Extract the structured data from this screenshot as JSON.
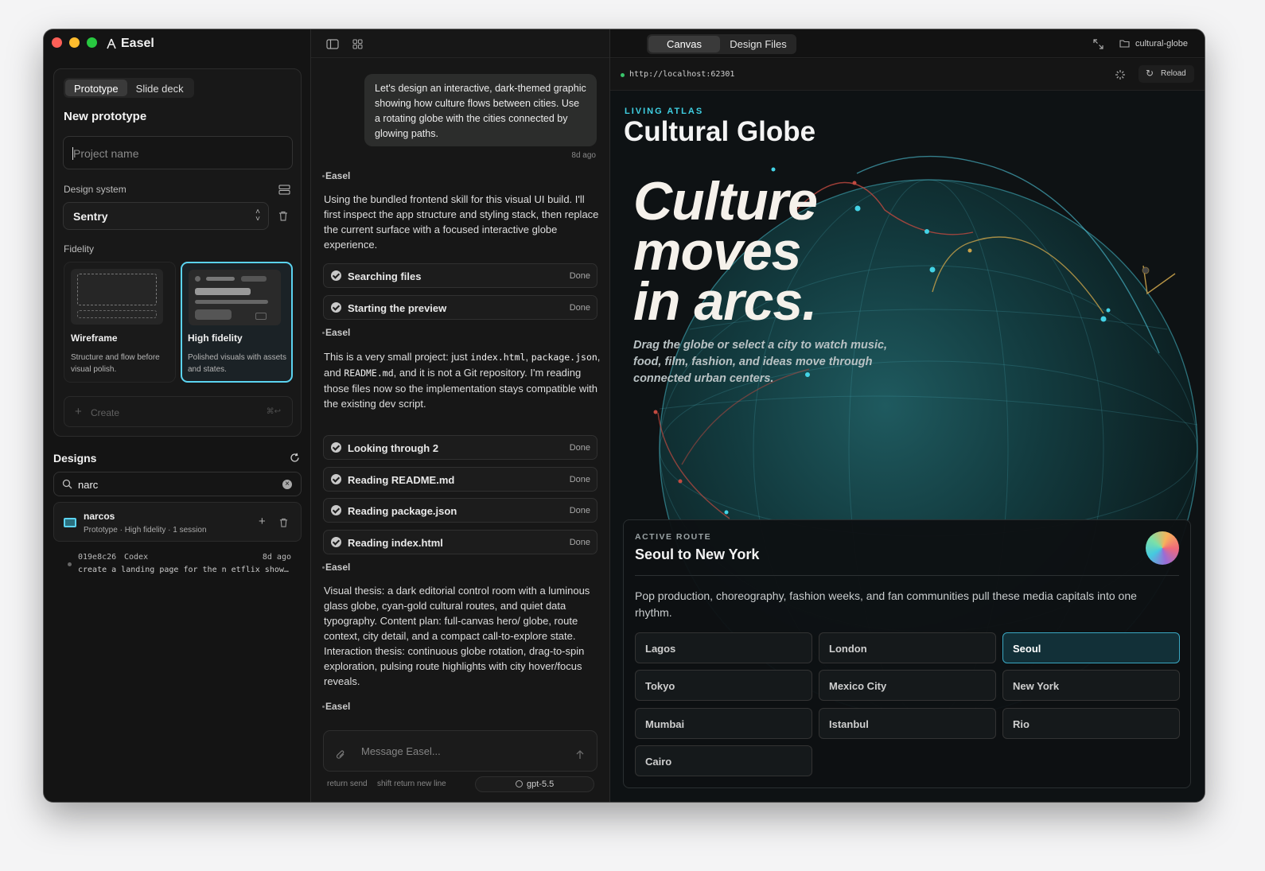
{
  "app": {
    "name": "Easel"
  },
  "left": {
    "tabs": [
      "Prototype",
      "Slide deck"
    ],
    "title": "New prototype",
    "project_placeholder": "Project name",
    "design_system_label": "Design system",
    "design_system_value": "Sentry",
    "fidelity_label": "Fidelity",
    "fidelity": [
      {
        "title": "Wireframe",
        "desc": "Structure and flow before visual polish."
      },
      {
        "title": "High fidelity",
        "desc": "Polished visuals with assets and states."
      }
    ],
    "create_label": "Create",
    "create_shortcut": "⌘↩",
    "designs_title": "Designs",
    "search_value": "narc",
    "design_item": {
      "name": "narcos",
      "meta": "Prototype · High fidelity · 1 session"
    },
    "session": {
      "id": "019e8c26",
      "agent": "Codex",
      "time": "8d ago",
      "text": "create a landing page for the n etflix show…"
    }
  },
  "chat": {
    "user_message": "Let's design an interactive, dark-themed graphic showing how culture flows between cities. Use a rotating globe with the cities connected by glowing paths.",
    "user_time": "8d ago",
    "speaker": "Easel",
    "msg1": "Using the bundled frontend skill for this visual UI build. I'll first inspect the app structure and styling stack, then replace the current surface with a focused interactive globe experience.",
    "steps1": [
      {
        "label": "Searching files",
        "status": "Done"
      },
      {
        "label": "Starting the preview",
        "status": "Done"
      }
    ],
    "msg2_a": "This is a very small project: just ",
    "msg2_code1": "index.html",
    "msg2_b": ", ",
    "msg2_code2": "package.json",
    "msg2_c": ", and ",
    "msg2_code3": "README.md",
    "msg2_d": ", and it is not a Git repository. I'm reading those files now so the implementation stays compatible with the existing dev script.",
    "steps2": [
      {
        "label": "Looking through 2",
        "status": "Done"
      },
      {
        "label": "Reading README.md",
        "status": "Done"
      },
      {
        "label": "Reading package.json",
        "status": "Done"
      },
      {
        "label": "Reading index.html",
        "status": "Done"
      }
    ],
    "msg3": "Visual thesis: a dark editorial control room with a luminous glass globe, cyan-gold cultural routes, and quiet data typography. Content plan: full-canvas hero/ globe, route context, city detail, and a compact call-to-explore state. Interaction thesis: continuous globe rotation, drag-to-spin exploration, pulsing route highlights with city hover/focus reveals.",
    "input_placeholder": "Message Easel...",
    "hint_send": "return send",
    "hint_newline": "shift return new line",
    "model": "gpt-5.5"
  },
  "preview": {
    "tabs": [
      "Canvas",
      "Design Files"
    ],
    "project": "cultural-globe",
    "url": "http://localhost:62301",
    "reload": "Reload",
    "kicker": "LIVING ATLAS",
    "site_title": "Cultural Globe",
    "hero_lines": [
      "Culture",
      "moves",
      "in arcs."
    ],
    "hero_sub": "Drag the globe or select a city to watch music, food, film, fashion, and ideas move through connected urban centers.",
    "route_kicker": "ACTIVE ROUTE",
    "route_title": "Seoul to New York",
    "route_desc": "Pop production, choreography, fashion weeks, and fan communities pull these media capitals into one rhythm.",
    "cities": [
      "Lagos",
      "London",
      "Seoul",
      "Tokyo",
      "Mexico City",
      "New York",
      "Mumbai",
      "Istanbul",
      "Rio",
      "Cairo"
    ],
    "selected_city": "Seoul"
  },
  "colors": {
    "accent": "#5bd3f0",
    "gold": "#c9a24a",
    "red": "#c4473f",
    "bg": "#121212"
  }
}
